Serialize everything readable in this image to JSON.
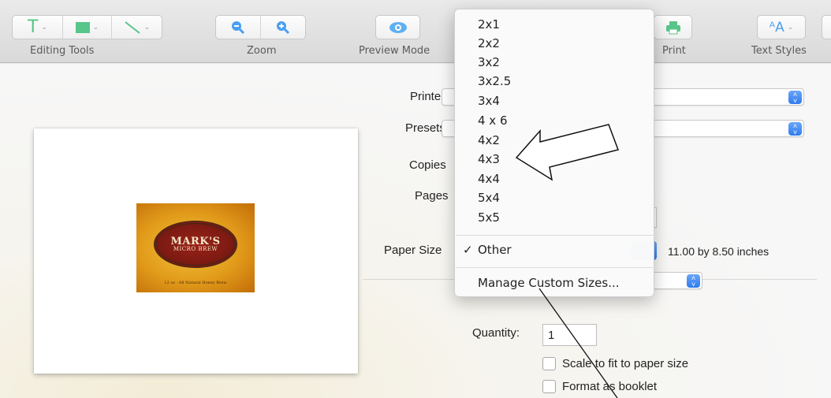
{
  "toolbar": {
    "editing_tools_label": "Editing Tools",
    "zoom_label": "Zoom",
    "preview_mode_label": "Preview Mode",
    "print_label": "Print",
    "text_styles_label": "Text Styles",
    "icons": {
      "text": "text-tool-icon",
      "shape": "shape-tool-icon",
      "line": "line-tool-icon",
      "zoom_out": "zoom-out-icon",
      "zoom_in": "zoom-in-icon",
      "preview": "eye-icon",
      "print": "printer-icon",
      "text_styles": "text-styles-icon"
    },
    "colors": {
      "accent_green": "#58c58a",
      "accent_blue": "#4a9ff0"
    }
  },
  "print_dialog": {
    "printer_label": "Printer",
    "presets_label": "Presets",
    "copies_label": "Copies",
    "pages_label": "Pages",
    "paper_size_label": "Paper Size",
    "paper_size_value": "11.00 by 8.50 inches",
    "quantity_label": "Quantity:",
    "quantity_value": "1",
    "scale_to_fit_label": "Scale to fit to paper size",
    "format_booklet_label": "Format as booklet"
  },
  "preview_label": {
    "title_line1": "MARK'S",
    "title_line2": "MICRO BREW",
    "footer": "12 oz · All Natural Honey Brew"
  },
  "paper_size_menu": {
    "items": [
      "2x1",
      "2x2",
      "3x2",
      "3x2.5",
      "3x4",
      "4 x 6",
      "4x2",
      "4x3",
      "4x4",
      "5x4",
      "5x5"
    ],
    "selected": "Other",
    "check": "✓",
    "manage": "Manage Custom Sizes..."
  }
}
